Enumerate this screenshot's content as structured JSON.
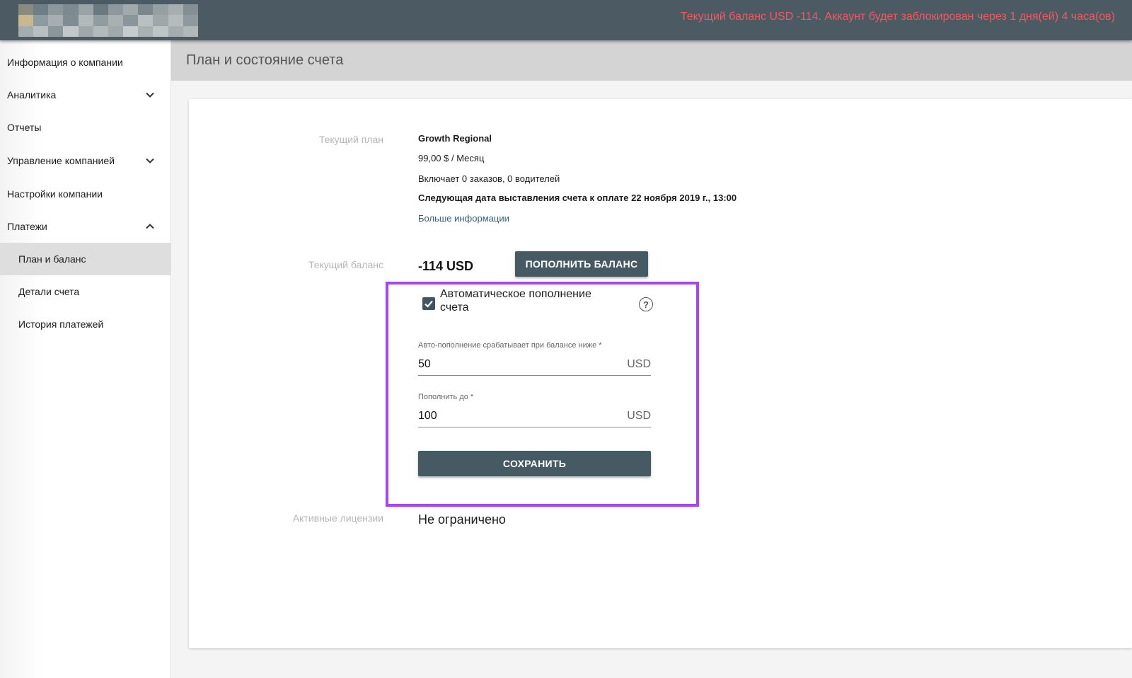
{
  "topbar": {
    "alert": "Текущий баланс USD -114. Аккаунт будет заблокирован через 1 дня(ей) 4 часа(ов)",
    "logo_colors": [
      "#8a8a7e",
      "#6e7e86",
      "#8b979c",
      "#7d8a90",
      "#9aa3a6",
      "#6a7880",
      "#8e989c",
      "#a1a9ac",
      "#7a878c",
      "#96a0a3",
      "#a7aeb0",
      "#838f94",
      "#c8b98c",
      "#8d9aa0",
      "#a6aeb1",
      "#7f8c91",
      "#b3b9bb",
      "#919ca0",
      "#a9b0b2",
      "#8a969b",
      "#bac0c2",
      "#9ea7aa",
      "#b6bcbe",
      "#8f9a9e",
      "#a3acaf",
      "#b9bfc1",
      "#8c979b",
      "#c2c7c8",
      "#9fa8ab",
      "#b4babc",
      "#a0a9ac",
      "#c6cbcc",
      "#aab1b3",
      "#bfc4c6",
      "#a5adb0",
      "#b1b8ba"
    ]
  },
  "sidebar": {
    "items": [
      {
        "label": "Информация о компании"
      },
      {
        "label": "Аналитика"
      },
      {
        "label": "Отчеты"
      },
      {
        "label": "Управление компанией"
      },
      {
        "label": "Настройки компании"
      },
      {
        "label": "Платежи"
      },
      {
        "label": "План и баланс"
      },
      {
        "label": "Детали счета"
      },
      {
        "label": "История платежей"
      }
    ]
  },
  "main": {
    "title": "План и состояние счета",
    "plan": {
      "label": "Текущий план",
      "name": "Growth Regional",
      "price": "99,00 $ / Месяц",
      "includes": "Включает 0 заказов, 0 водителей",
      "next_billing": "Следующая дата выставления счета к оплате 22 ноября 2019 г., 13:00",
      "more_info": "Больше информации"
    },
    "balance": {
      "label": "Текущий баланс",
      "value": "-114 USD",
      "topup_button": "ПОПОЛНИТЬ БАЛАНС"
    },
    "auto_topup": {
      "checkbox_label_line1": "Автоматическое пополнение",
      "checkbox_label_line2": "счета",
      "checked": true,
      "threshold_label": "Авто-пополнение срабатывает при балансе ниже *",
      "threshold_value": "50",
      "threshold_unit": "USD",
      "target_label": "Пополнить до *",
      "target_value": "100",
      "target_unit": "USD",
      "save_button": "СОХРАНИТЬ"
    },
    "licenses": {
      "label": "Активные лицензии",
      "value": "Не ограничено"
    }
  }
}
